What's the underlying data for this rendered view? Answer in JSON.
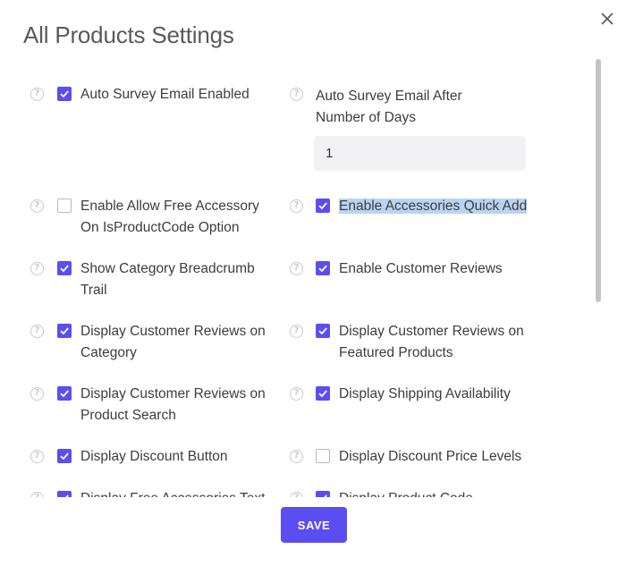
{
  "modal": {
    "title": "All Products Settings",
    "close_icon": "close-icon",
    "save_label": "SAVE",
    "accent_color": "#5b4ef0"
  },
  "settings": {
    "auto_survey_email_enabled": {
      "label": "Auto Survey Email Enabled",
      "checked": true
    },
    "auto_survey_email_days": {
      "label": "Auto Survey Email After Number of Days",
      "value": "1"
    },
    "allow_free_accessory": {
      "label": "Enable Allow Free Accessory On IsProductCode Option",
      "checked": false
    },
    "accessories_quick_add": {
      "label": "Enable Accessories Quick Add",
      "checked": true,
      "selected_text": true
    },
    "category_breadcrumb": {
      "label": "Show Category Breadcrumb Trail",
      "checked": true
    },
    "customer_reviews": {
      "label": "Enable Customer Reviews",
      "checked": true
    },
    "reviews_on_category": {
      "label": "Display Customer Reviews on Category",
      "checked": true
    },
    "reviews_on_featured": {
      "label": "Display Customer Reviews on Featured Products",
      "checked": true
    },
    "reviews_on_search": {
      "label": "Display Customer Reviews on Product Search",
      "checked": true
    },
    "shipping_availability": {
      "label": "Display Shipping Availability",
      "checked": true
    },
    "discount_button": {
      "label": "Display Discount Button",
      "checked": true
    },
    "discount_price_levels": {
      "label": "Display Discount Price Levels",
      "checked": false
    },
    "free_accessories_text": {
      "label": "Display Free Accessories Text",
      "checked": true
    },
    "product_code": {
      "label": "Display Product Code",
      "checked": true
    }
  }
}
